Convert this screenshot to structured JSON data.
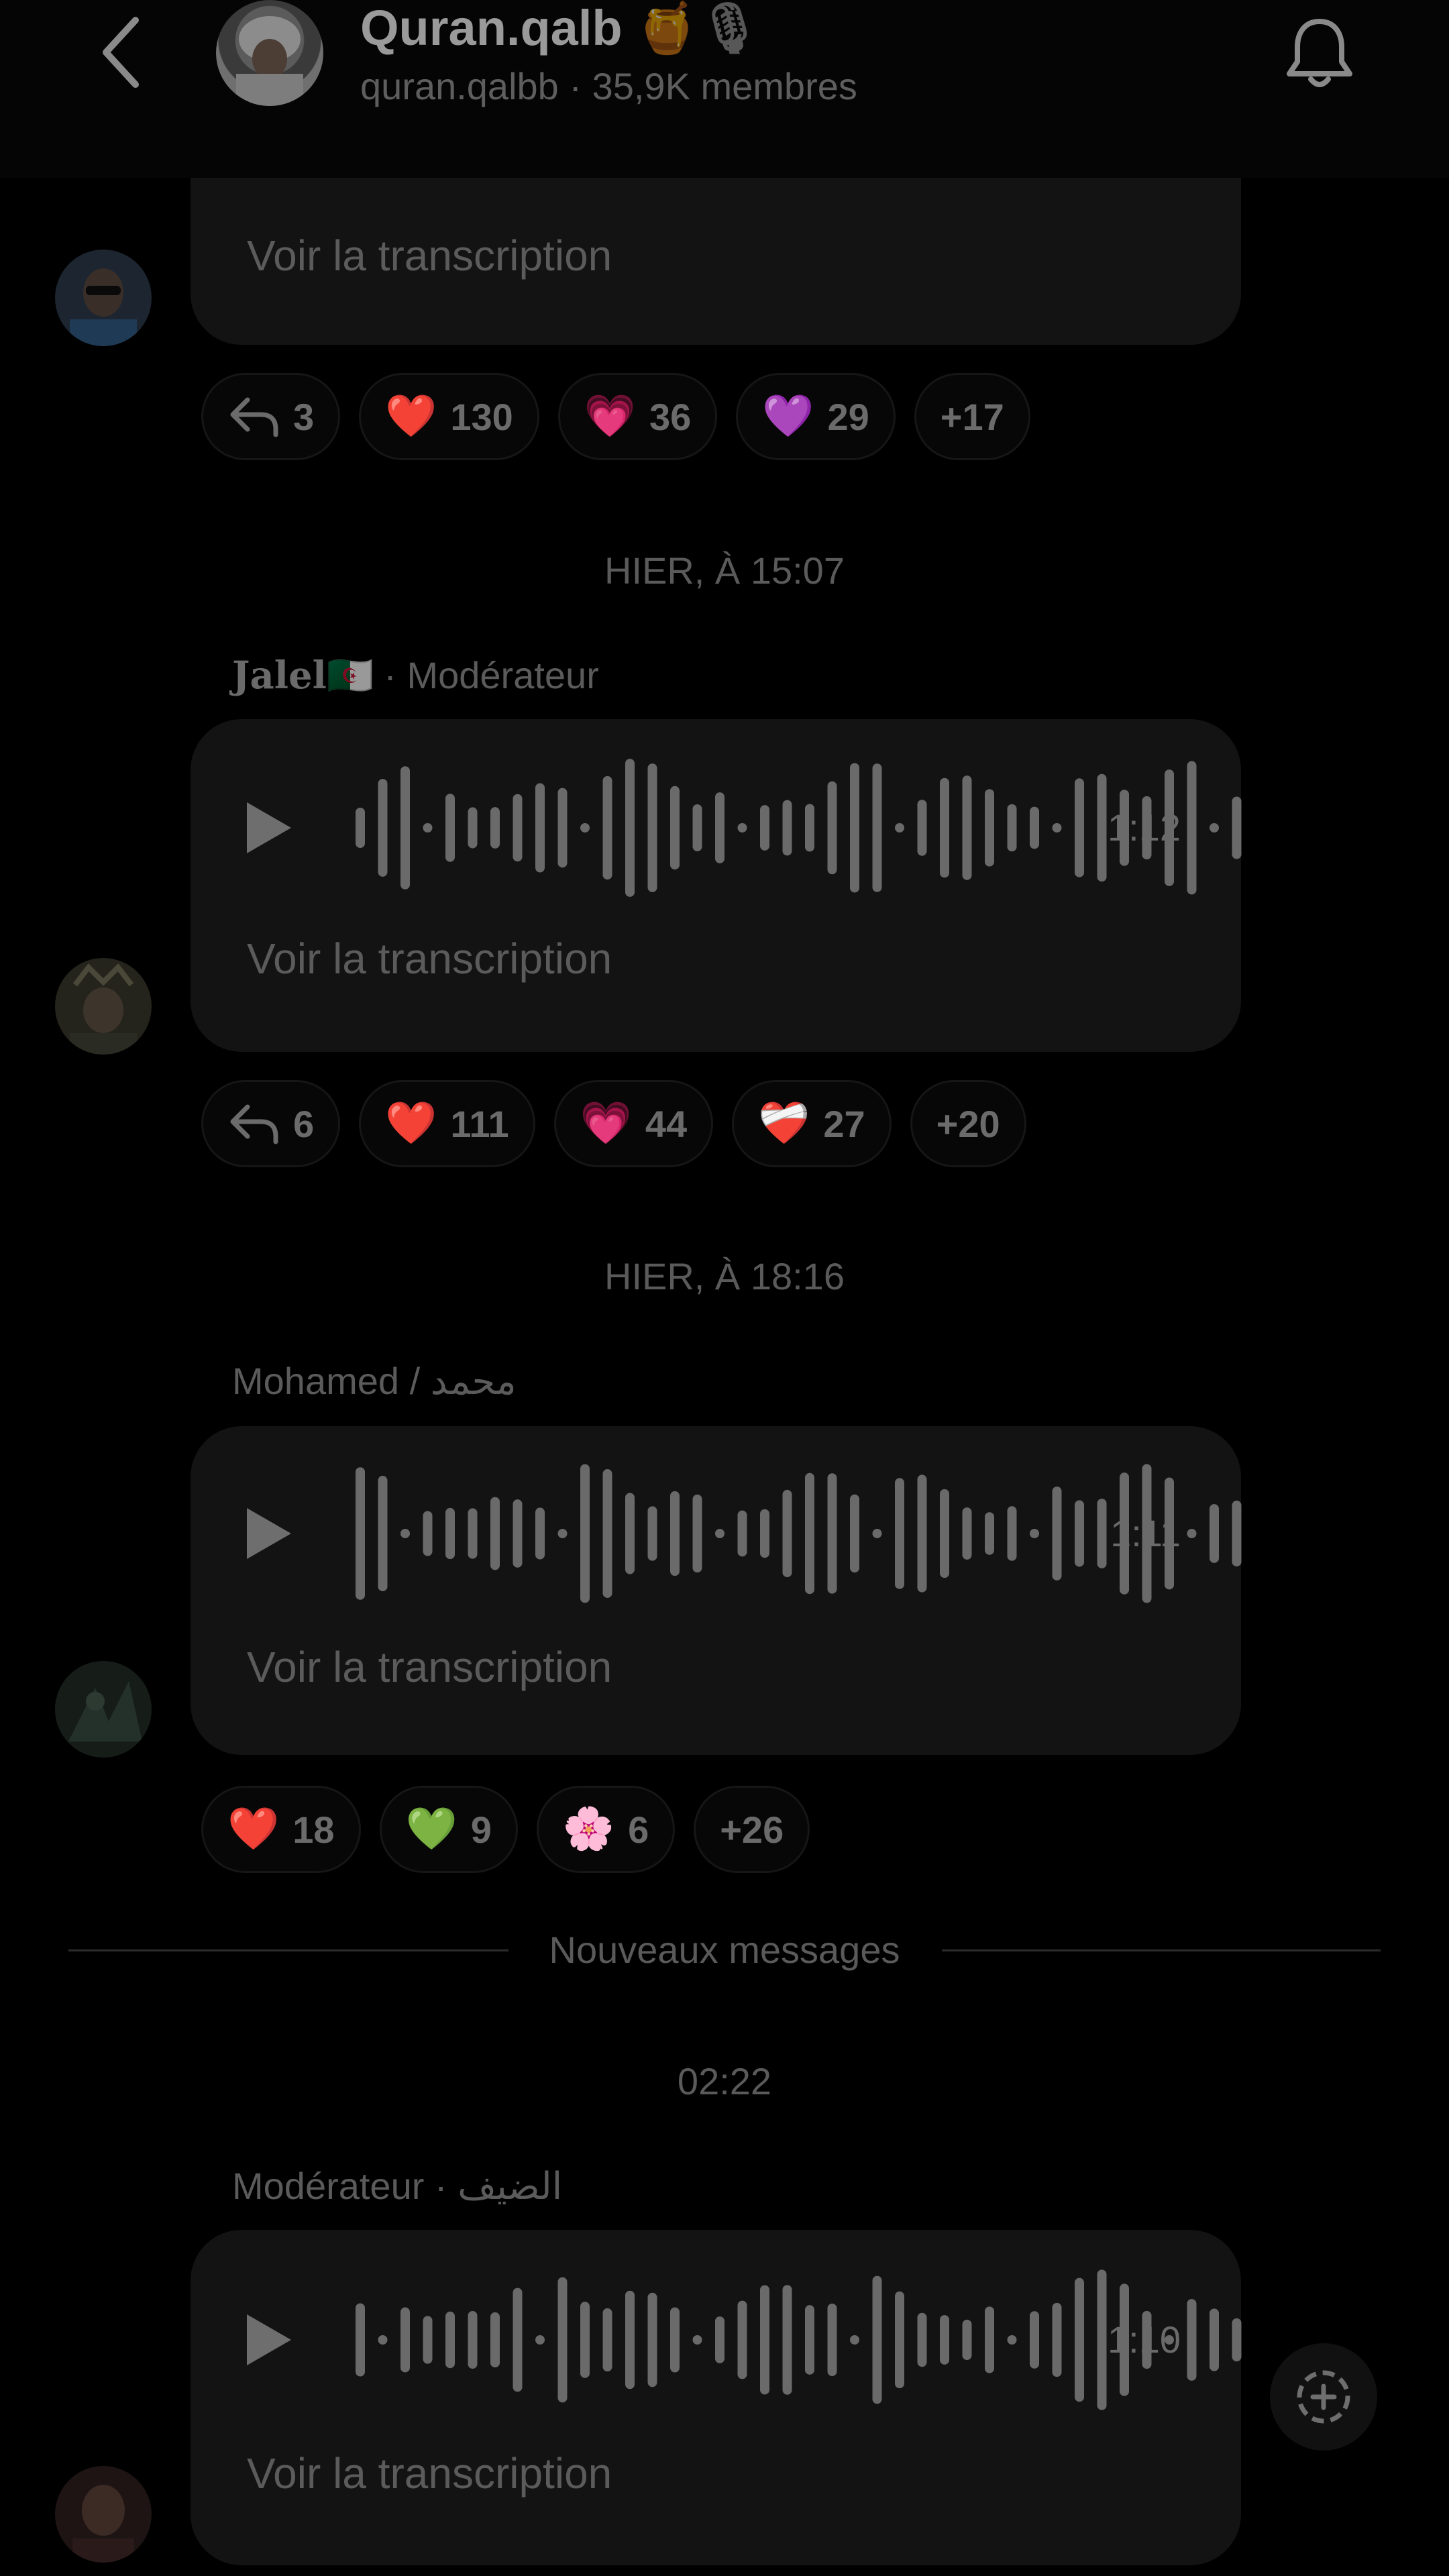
{
  "header": {
    "title": "Quran.qalb",
    "title_emoji": "🍯🎙",
    "handle": "quran.qalbb",
    "members": " · 35,9K membres",
    "back_icon": "chevron-left-icon",
    "bell_icon": "bell-icon"
  },
  "colors": {
    "background": "#000000",
    "bubble": "#131313",
    "text": "#8e8e8e"
  },
  "messages": [
    {
      "transcript": "Voir la transcription",
      "reactions": [
        {
          "icon": "reply-icon",
          "count": "3"
        },
        {
          "emoji": "❤️",
          "icon": "red-heart-icon",
          "count": "130"
        },
        {
          "emoji": "💗",
          "icon": "pink-heart-icon",
          "count": "36"
        },
        {
          "emoji": "💜",
          "icon": "purple-heart-icon",
          "count": "29"
        },
        {
          "count": "+17"
        }
      ]
    },
    {
      "timestamp": "HIER, À 15:07",
      "sender_name": "Jalel",
      "sender_flag": "🇩🇿",
      "sender_role": " · Modérateur",
      "duration": "1:12",
      "transcript": "Voir la transcription",
      "reactions": [
        {
          "icon": "reply-icon",
          "count": "6"
        },
        {
          "emoji": "❤️",
          "icon": "red-heart-icon",
          "count": "111"
        },
        {
          "emoji": "💗",
          "icon": "pink-heart-icon",
          "count": "44"
        },
        {
          "emoji": "❤️‍🩹",
          "icon": "mending-heart-icon",
          "count": "27"
        },
        {
          "count": "+20"
        }
      ]
    },
    {
      "timestamp": "HIER, À 18:16",
      "sender_name": "Mohamed / محمد",
      "duration": "1:11",
      "transcript": "Voir la transcription",
      "reactions": [
        {
          "emoji": "❤️",
          "icon": "red-heart-icon",
          "count": "18"
        },
        {
          "emoji": "💚",
          "icon": "green-heart-icon",
          "count": "9"
        },
        {
          "emoji": "🌸",
          "icon": "cherry-blossom-icon",
          "count": "6"
        },
        {
          "count": "+26"
        }
      ]
    },
    {
      "divider": "Nouveaux messages",
      "timestamp": "02:22",
      "sender_name": "Modérateur · الضيف",
      "duration": "1:10",
      "transcript": "Voir la transcription"
    }
  ],
  "add_button_icon": "add-reaction-icon"
}
